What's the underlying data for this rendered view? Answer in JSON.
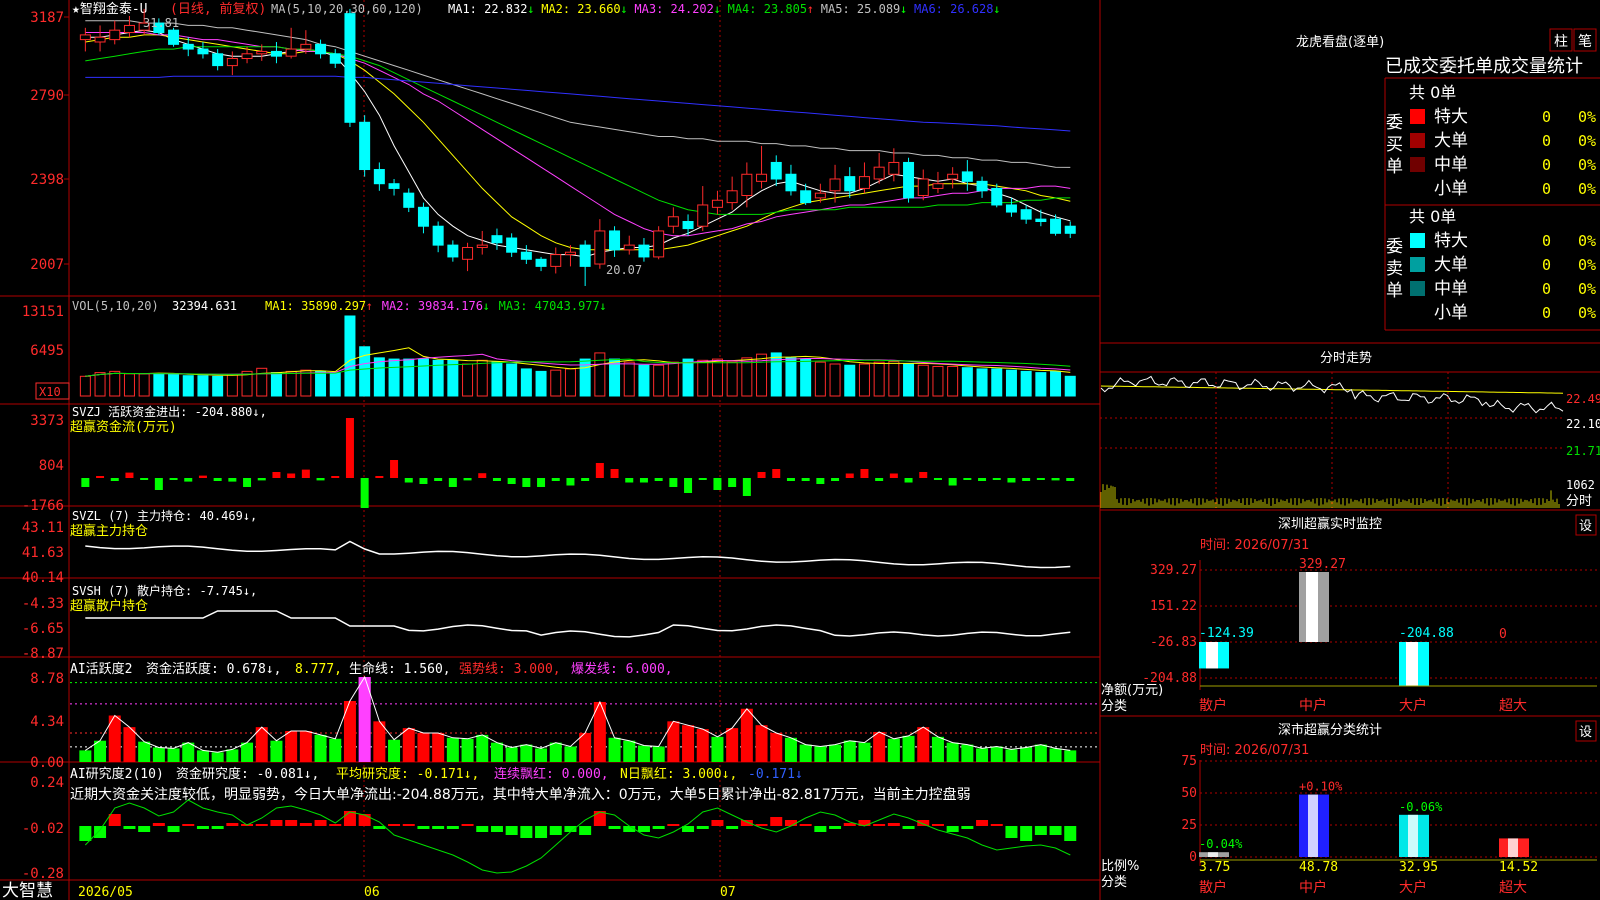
{
  "colors": {
    "up": "#ff2b2b",
    "down": "#00ffff",
    "grid": "#b00000",
    "gray": "#c0c0c0",
    "yellow": "#ffff00",
    "magenta": "#ff40ff",
    "green": "#00e000",
    "white": "#ffffff",
    "blue": "#3030ff",
    "bar_green": "#00ff00"
  },
  "app": {
    "brand": "大智慧",
    "dates": [
      "2026/05",
      "06",
      "07"
    ]
  },
  "kline": {
    "title": "★智翔金泰-U",
    "period": "(日线, 前复权)",
    "ma_def": "MA(5,10,20,30,60,120)",
    "ma": [
      {
        "label": "MA1: 22.832",
        "arrow": "↓",
        "color": "#ffffff"
      },
      {
        "label": "MA2: 23.660",
        "arrow": "↓",
        "color": "#ffff00"
      },
      {
        "label": "MA3: 24.202",
        "arrow": "↓",
        "color": "#ff40ff"
      },
      {
        "label": "MA4: 23.805",
        "arrow": "↑",
        "color": "#00e000"
      },
      {
        "label": "MA5: 25.089",
        "arrow": "↓",
        "color": "#c0c0c0"
      },
      {
        "label": "MA6: 26.628",
        "arrow": "↓",
        "color": "#3030ff"
      }
    ],
    "y_ticks": [
      "3187",
      "2790",
      "2398",
      "2007"
    ],
    "high_label": "31.81",
    "low_label": "20.07",
    "candles": [
      [
        30.5,
        30.7,
        30.0,
        31.0
      ],
      [
        30.4,
        30.6,
        30.0,
        31.1
      ],
      [
        30.5,
        30.9,
        30.3,
        31.3
      ],
      [
        30.8,
        31.1,
        30.6,
        31.5
      ],
      [
        30.9,
        31.2,
        30.7,
        31.8
      ],
      [
        31.2,
        30.8,
        30.7,
        31.4
      ],
      [
        30.9,
        30.3,
        30.2,
        31.0
      ],
      [
        30.3,
        30.1,
        29.8,
        30.6
      ],
      [
        30.1,
        29.9,
        29.7,
        30.4
      ],
      [
        29.9,
        29.4,
        29.2,
        30.1
      ],
      [
        29.4,
        29.7,
        29.0,
        30.0
      ],
      [
        29.7,
        29.9,
        29.5,
        30.2
      ],
      [
        29.9,
        30.0,
        29.6,
        30.3
      ],
      [
        30.0,
        29.8,
        29.5,
        30.4
      ],
      [
        29.8,
        30.1,
        29.7,
        31.0
      ],
      [
        30.1,
        30.3,
        29.9,
        30.9
      ],
      [
        30.3,
        29.9,
        29.7,
        30.5
      ],
      [
        29.9,
        29.5,
        29.3,
        30.1
      ],
      [
        31.6,
        27.0,
        26.8,
        31.8
      ],
      [
        27.0,
        25.0,
        24.7,
        27.3
      ],
      [
        25.0,
        24.4,
        24.1,
        25.3
      ],
      [
        24.4,
        24.2,
        23.9,
        24.6
      ],
      [
        24.0,
        23.4,
        23.2,
        24.2
      ],
      [
        23.4,
        22.6,
        22.3,
        23.6
      ],
      [
        22.6,
        21.8,
        21.5,
        22.8
      ],
      [
        21.8,
        21.3,
        21.1,
        22.0
      ],
      [
        21.2,
        21.7,
        20.7,
        21.9
      ],
      [
        21.7,
        21.8,
        21.4,
        22.4
      ],
      [
        22.2,
        21.9,
        21.6,
        22.5
      ],
      [
        22.1,
        21.5,
        21.3,
        22.3
      ],
      [
        21.5,
        21.2,
        21.0,
        21.8
      ],
      [
        21.2,
        20.9,
        20.7,
        21.3
      ],
      [
        20.9,
        21.4,
        20.6,
        21.7
      ],
      [
        21.4,
        21.5,
        20.9,
        21.8
      ],
      [
        21.8,
        20.9,
        20.07,
        22.0
      ],
      [
        21.0,
        22.4,
        20.8,
        22.9
      ],
      [
        22.4,
        21.6,
        21.3,
        22.6
      ],
      [
        21.6,
        21.8,
        21.4,
        22.2
      ],
      [
        21.8,
        21.3,
        21.1,
        22.1
      ],
      [
        21.3,
        22.4,
        21.2,
        22.6
      ],
      [
        22.6,
        23.0,
        22.3,
        23.4
      ],
      [
        22.8,
        22.5,
        22.2,
        23.1
      ],
      [
        22.6,
        23.5,
        22.4,
        24.3
      ],
      [
        23.4,
        23.7,
        23.1,
        24.1
      ],
      [
        23.6,
        24.1,
        23.3,
        24.7
      ],
      [
        23.9,
        24.8,
        23.4,
        25.3
      ],
      [
        24.5,
        24.8,
        24.2,
        26.0
      ],
      [
        25.3,
        24.6,
        24.3,
        25.6
      ],
      [
        24.8,
        24.1,
        23.9,
        25.2
      ],
      [
        24.1,
        23.6,
        23.5,
        24.4
      ],
      [
        23.8,
        24.0,
        23.6,
        24.4
      ],
      [
        24.1,
        24.6,
        23.6,
        25.2
      ],
      [
        24.7,
        24.1,
        23.8,
        25.1
      ],
      [
        24.2,
        24.7,
        24.0,
        25.3
      ],
      [
        24.6,
        25.1,
        24.4,
        25.7
      ],
      [
        24.8,
        25.3,
        24.5,
        25.9
      ],
      [
        25.3,
        23.8,
        23.6,
        25.5
      ],
      [
        23.9,
        24.6,
        23.7,
        25.0
      ],
      [
        24.2,
        24.4,
        24.0,
        24.9
      ],
      [
        24.6,
        24.8,
        24.2,
        25.1
      ],
      [
        24.9,
        24.5,
        24.1,
        25.4
      ],
      [
        24.5,
        24.1,
        23.8,
        24.7
      ],
      [
        24.2,
        23.5,
        23.4,
        24.4
      ],
      [
        23.5,
        23.2,
        23.0,
        23.8
      ],
      [
        23.3,
        22.9,
        22.7,
        23.5
      ],
      [
        22.9,
        22.8,
        22.6,
        23.3
      ],
      [
        22.9,
        22.3,
        22.2,
        23.1
      ],
      [
        22.6,
        22.3,
        22.1,
        22.8
      ]
    ],
    "ma_lines": {
      "ma1": [
        30.6,
        30.6,
        30.7,
        30.8,
        30.9,
        30.8,
        30.5,
        30.3,
        30.1,
        29.9,
        29.8,
        29.8,
        29.8,
        29.9,
        30.0,
        30.1,
        30.0,
        29.8,
        29.1,
        28.3,
        27.3,
        26.0,
        24.9,
        23.8,
        23.1,
        22.6,
        22.2,
        22.0,
        21.8,
        21.7,
        21.6,
        21.5,
        21.4,
        21.4,
        21.3,
        21.5,
        21.6,
        21.7,
        21.7,
        21.8,
        22.1,
        22.3,
        22.6,
        22.9,
        23.2,
        23.7,
        24.1,
        24.4,
        24.5,
        24.3,
        24.1,
        24.0,
        24.0,
        24.2,
        24.5,
        24.8,
        24.7,
        24.6,
        24.5,
        24.6,
        24.4,
        24.3,
        24.0,
        23.8,
        23.5,
        23.2,
        23.0,
        22.83
      ],
      "ma2": [
        30.4,
        30.5,
        30.6,
        30.6,
        30.7,
        30.7,
        30.6,
        30.5,
        30.4,
        30.3,
        30.2,
        30.1,
        30.0,
        29.9,
        29.9,
        30.0,
        30.0,
        29.9,
        29.6,
        29.2,
        28.7,
        28.2,
        27.6,
        27.0,
        26.3,
        25.6,
        24.9,
        24.2,
        23.6,
        23.0,
        22.6,
        22.2,
        21.9,
        21.7,
        21.6,
        21.6,
        21.6,
        21.6,
        21.6,
        21.6,
        21.7,
        21.8,
        22.0,
        22.2,
        22.4,
        22.6,
        22.9,
        23.2,
        23.4,
        23.6,
        23.7,
        23.8,
        23.9,
        24.0,
        24.1,
        24.2,
        24.3,
        24.3,
        24.4,
        24.4,
        24.4,
        24.4,
        24.3,
        24.2,
        24.1,
        23.9,
        23.8,
        23.66
      ],
      "ma3": [
        30.8,
        30.8,
        30.8,
        30.8,
        30.8,
        30.7,
        30.7,
        30.6,
        30.5,
        30.5,
        30.4,
        30.3,
        30.2,
        30.2,
        30.1,
        30.0,
        30.0,
        29.9,
        29.7,
        29.5,
        29.2,
        28.9,
        28.6,
        28.2,
        27.9,
        27.5,
        27.1,
        26.7,
        26.3,
        25.9,
        25.5,
        25.1,
        24.7,
        24.3,
        23.9,
        23.5,
        23.1,
        22.8,
        22.5,
        22.3,
        22.2,
        22.2,
        22.3,
        22.4,
        22.5,
        22.7,
        22.8,
        23.0,
        23.1,
        23.2,
        23.3,
        23.4,
        23.5,
        23.5,
        23.6,
        23.7,
        23.8,
        23.8,
        23.9,
        24.0,
        24.0,
        24.1,
        24.2,
        24.2,
        24.2,
        24.3,
        24.3,
        24.2
      ],
      "ma4": [
        29.6,
        29.7,
        29.8,
        29.9,
        30.0,
        30.1,
        30.1,
        30.2,
        30.2,
        30.2,
        30.2,
        30.2,
        30.2,
        30.2,
        30.1,
        30.1,
        30.0,
        29.9,
        29.8,
        29.6,
        29.4,
        29.1,
        28.8,
        28.5,
        28.2,
        27.9,
        27.6,
        27.3,
        27.0,
        26.7,
        26.4,
        26.1,
        25.8,
        25.5,
        25.2,
        24.9,
        24.6,
        24.3,
        24.0,
        23.7,
        23.5,
        23.3,
        23.2,
        23.1,
        23.1,
        23.1,
        23.1,
        23.2,
        23.3,
        23.3,
        23.3,
        23.3,
        23.4,
        23.4,
        23.4,
        23.4,
        23.4,
        23.4,
        23.5,
        23.5,
        23.5,
        23.6,
        23.6,
        23.6,
        23.7,
        23.7,
        23.8,
        23.8
      ],
      "ma5": [
        31.3,
        31.3,
        31.3,
        31.3,
        31.2,
        31.2,
        31.2,
        31.1,
        31.1,
        31.0,
        31.0,
        30.9,
        30.8,
        30.7,
        30.6,
        30.5,
        30.3,
        30.2,
        30.0,
        29.8,
        29.6,
        29.4,
        29.2,
        29.0,
        28.8,
        28.6,
        28.4,
        28.2,
        28.0,
        27.8,
        27.6,
        27.4,
        27.2,
        27.0,
        26.9,
        26.8,
        26.7,
        26.6,
        26.5,
        26.4,
        26.4,
        26.3,
        26.3,
        26.2,
        26.2,
        26.2,
        26.1,
        26.1,
        26.0,
        26.0,
        25.9,
        25.9,
        25.8,
        25.8,
        25.8,
        25.7,
        25.7,
        25.6,
        25.6,
        25.5,
        25.5,
        25.4,
        25.4,
        25.3,
        25.3,
        25.2,
        25.1,
        25.09
      ],
      "ma6": [
        28.9,
        28.9,
        28.9,
        28.9,
        28.9,
        28.9,
        28.95,
        28.95,
        28.95,
        28.95,
        28.95,
        28.95,
        28.95,
        28.95,
        28.95,
        28.95,
        28.95,
        28.95,
        28.9,
        28.9,
        28.85,
        28.8,
        28.75,
        28.7,
        28.65,
        28.6,
        28.55,
        28.5,
        28.45,
        28.4,
        28.35,
        28.3,
        28.25,
        28.2,
        28.15,
        28.1,
        28.05,
        28.0,
        27.95,
        27.9,
        27.85,
        27.8,
        27.75,
        27.7,
        27.65,
        27.6,
        27.55,
        27.5,
        27.45,
        27.4,
        27.35,
        27.3,
        27.25,
        27.2,
        27.15,
        27.1,
        27.05,
        27.0,
        26.98,
        26.95,
        26.92,
        26.88,
        26.85,
        26.8,
        26.76,
        26.72,
        26.68,
        26.63
      ]
    }
  },
  "volume": {
    "def": "VOL(5,10,20)",
    "value": "32394.631",
    "ma": [
      {
        "label": "MA1: 35890.297",
        "arrow": "↑",
        "color": "#ffff00"
      },
      {
        "label": "MA2: 39834.176",
        "arrow": "↓",
        "color": "#ff40ff"
      },
      {
        "label": "MA3: 47043.977",
        "arrow": "↓",
        "color": "#00e000"
      }
    ],
    "y_ticks": [
      "13151",
      "6495"
    ],
    "unit": "X10",
    "bars": [
      32,
      38,
      40,
      36,
      36,
      36,
      36,
      33,
      33,
      32,
      34,
      40,
      45,
      38,
      40,
      42,
      40,
      38,
      130,
      80,
      62,
      60,
      60,
      60,
      58,
      58,
      52,
      58,
      55,
      52,
      44,
      40,
      42,
      44,
      60,
      70,
      60,
      55,
      50,
      50,
      55,
      60,
      58,
      60,
      55,
      62,
      68,
      70,
      62,
      60,
      55,
      52,
      50,
      52,
      55,
      56,
      52,
      50,
      48,
      48,
      46,
      44,
      44,
      42,
      40,
      38,
      40,
      32
    ]
  },
  "svzj": {
    "label1": "SVZJ  活跃资金进出: -204.880↓,",
    "label2": "超赢资金流(万元)",
    "y_ticks": [
      "3373",
      "804",
      "-1766"
    ],
    "values": [
      -300,
      50,
      -100,
      180,
      -60,
      -400,
      -50,
      -120,
      80,
      -100,
      -120,
      -300,
      -80,
      200,
      150,
      280,
      -80,
      30,
      2000,
      -1000,
      30,
      600,
      -150,
      -200,
      -100,
      -300,
      -80,
      160,
      -100,
      -200,
      -300,
      -300,
      -100,
      -250,
      -100,
      500,
      300,
      -150,
      -150,
      -100,
      -300,
      -500,
      -50,
      -400,
      -300,
      -600,
      200,
      300,
      -100,
      -100,
      -200,
      -100,
      150,
      300,
      -100,
      150,
      -150,
      200,
      -50,
      -250,
      -50,
      -100,
      -50,
      -150,
      -100,
      -50,
      -80,
      -100
    ]
  },
  "svzl": {
    "label1": "SVZL (7) 主力持仓: 40.469↓,",
    "label2": "超赢主力持仓",
    "y_ticks": [
      "43.11",
      "41.63",
      "40.14"
    ]
  },
  "svsh": {
    "label1": "SVSH (7) 散户持仓: -7.745↓,",
    "label2": "超赢散户持仓",
    "y_ticks": [
      "-4.33",
      "-6.65",
      "-8.87"
    ]
  },
  "ai1": {
    "title": "AI活跃度2",
    "label_a": "资金活跃度: 0.678↓,",
    "label_b": "8.777,",
    "label_c": "生命线: 1.560,",
    "label_d": "强势线: 3.000,",
    "label_e": "爆发线: 6.000,",
    "y_ticks": [
      "8.78",
      "4.34",
      "0.00"
    ],
    "values": [
      1.2,
      2.2,
      4.8,
      3.6,
      2.1,
      1.5,
      1.4,
      2.0,
      1.2,
      1.0,
      1.3,
      2.0,
      3.6,
      2.2,
      3.2,
      3.2,
      2.8,
      2.4,
      6.3,
      8.78,
      4.2,
      2.3,
      3.5,
      3.0,
      3.0,
      2.5,
      2.4,
      2.8,
      2.0,
      1.5,
      1.8,
      1.4,
      2.0,
      1.6,
      3.0,
      6.2,
      2.5,
      2.2,
      1.7,
      1.6,
      4.2,
      3.8,
      3.4,
      2.6,
      3.5,
      5.5,
      3.8,
      3.0,
      2.5,
      1.8,
      1.6,
      1.8,
      2.2,
      2.0,
      3.1,
      2.4,
      2.7,
      3.6,
      2.6,
      2.0,
      1.8,
      1.4,
      1.6,
      1.3,
      1.5,
      1.8,
      1.4,
      1.2
    ]
  },
  "ai2": {
    "title": "AI研究度2(10)",
    "label_a": "资金研究度: -0.081↓,",
    "label_b": "平均研究度: -0.171↓,",
    "label_c": "连续飘红: 0.000,",
    "label_d": "N日飘红: 3.000↓,",
    "label_e": "-0.171↓",
    "line2": "近期大资金关注度较低，明显弱势，今日大单净流出:-204.88万元，其中特大单净流入：0万元，大单5日累计净出-82.817万元，当前主力控盘弱",
    "y_ticks": [
      "0.24",
      "-0.02",
      "-0.28"
    ],
    "values": [
      -0.05,
      -0.04,
      0.04,
      -0.01,
      -0.02,
      0.01,
      -0.02,
      0.0,
      -0.01,
      -0.01,
      0.01,
      0.0,
      0.0,
      0.02,
      0.02,
      0.01,
      0.02,
      0.0,
      0.05,
      0.04,
      -0.01,
      0.0,
      0.0,
      -0.01,
      -0.01,
      -0.01,
      0.0,
      -0.02,
      -0.02,
      -0.03,
      -0.04,
      -0.04,
      -0.03,
      -0.02,
      -0.03,
      0.05,
      -0.01,
      -0.02,
      -0.02,
      -0.01,
      0.0,
      -0.02,
      -0.01,
      0.02,
      -0.01,
      0.02,
      0.0,
      0.03,
      0.02,
      0.0,
      -0.02,
      -0.01,
      0.01,
      0.02,
      0.0,
      0.01,
      -0.01,
      0.02,
      0.0,
      -0.02,
      -0.01,
      0.02,
      0.0,
      -0.04,
      -0.05,
      -0.03,
      -0.03,
      -0.05
    ]
  },
  "lhkp": {
    "title": "龙虎看盘(逐单)",
    "btn_zhu": "柱",
    "btn_bi": "笔",
    "header": "已成交委托单成交量统计",
    "buy_label": "委买单",
    "sell_label": "委卖单",
    "buy_total": "共 0单",
    "sell_total": "共 0单",
    "buy_rows": [
      {
        "name": "特大",
        "val": "0",
        "pct": "0%",
        "color": "#ff0000"
      },
      {
        "name": "大单",
        "val": "0",
        "pct": "0%",
        "color": "#a00000"
      },
      {
        "name": "中单",
        "val": "0",
        "pct": "0%",
        "color": "#700000"
      },
      {
        "name": "小单",
        "val": "0",
        "pct": "0%",
        "color": "#000000"
      }
    ],
    "sell_rows": [
      {
        "name": "特大",
        "val": "0",
        "pct": "0%",
        "color": "#00ffff"
      },
      {
        "name": "大单",
        "val": "0",
        "pct": "0%",
        "color": "#00a0a0"
      },
      {
        "name": "中单",
        "val": "0",
        "pct": "0%",
        "color": "#007070"
      },
      {
        "name": "小单",
        "val": "0",
        "pct": "0%",
        "color": "#000000"
      }
    ]
  },
  "fenshi": {
    "title": "分时走势",
    "prices": [
      "22.49",
      "22.10",
      "21.71"
    ],
    "vol": "1062",
    "vol_label": "分时"
  },
  "szss": {
    "title": "深圳超赢实时监控",
    "btn": "设",
    "time": "时间: 2026/07/31",
    "y_ticks": [
      "329.27",
      "151.22",
      "-26.83",
      "-204.88"
    ],
    "y_label": "净额(万元)",
    "x_label": "分类",
    "cats": [
      "散户",
      "中户",
      "大户",
      "超大"
    ],
    "values": [
      -124.39,
      329.27,
      -204.88,
      0
    ],
    "value_labels": [
      "-124.39",
      "329.27",
      "-204.88",
      "0"
    ]
  },
  "fltj": {
    "title": "深市超赢分类统计",
    "btn": "设",
    "time": "时间: 2026/07/31",
    "y_ticks": [
      "75",
      "50",
      "25",
      "0"
    ],
    "y_label": "比例%",
    "x_label": "分类",
    "cats": [
      "散户",
      "中户",
      "大户",
      "超大"
    ],
    "values": [
      3.75,
      48.78,
      32.95,
      14.52
    ],
    "value_labels": [
      "3.75",
      "48.78",
      "32.95",
      "14.52"
    ],
    "changes": [
      "-0.04%",
      "+0.10%",
      "-0.06%",
      ""
    ]
  }
}
